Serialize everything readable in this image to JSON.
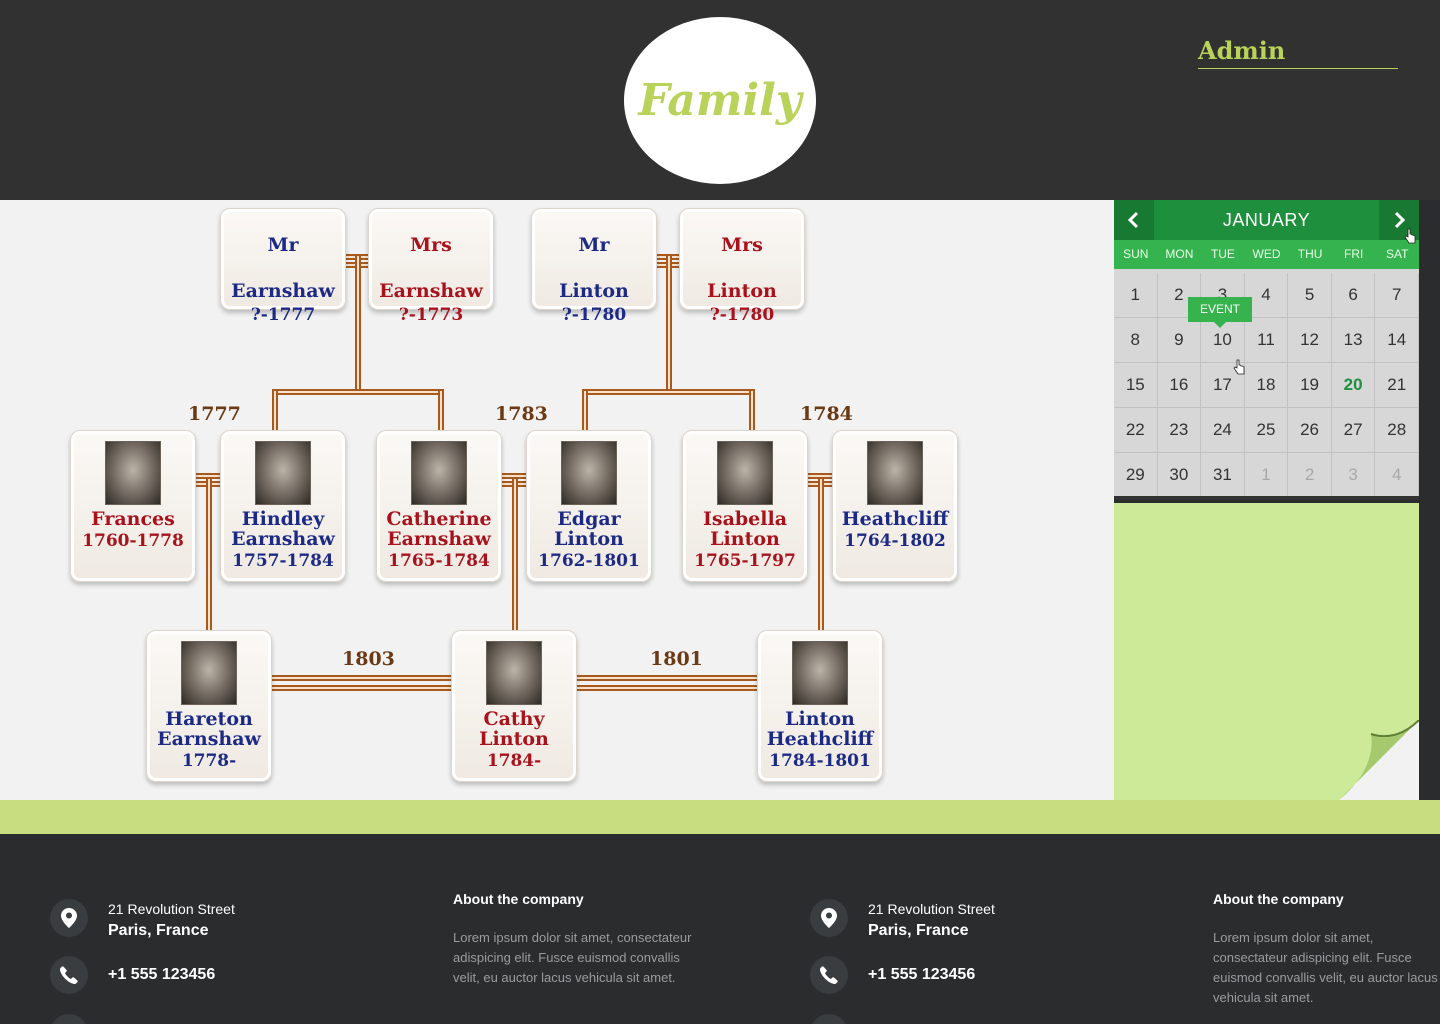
{
  "header": {
    "logo": "Family",
    "admin_link": "Admin"
  },
  "family_tree": {
    "grandparents": [
      {
        "name_line1": "Mr",
        "name_line2": "Earnshaw",
        "years": "?-1777",
        "sex": "male"
      },
      {
        "name_line1": "Mrs",
        "name_line2": "Earnshaw",
        "years": "?-1773",
        "sex": "female"
      },
      {
        "name_line1": "Mr",
        "name_line2": "Linton",
        "years": "?-1780",
        "sex": "male"
      },
      {
        "name_line1": "Mrs",
        "name_line2": "Linton",
        "years": "?-1780",
        "sex": "female"
      }
    ],
    "parents": [
      {
        "name_line1": "Frances",
        "name_line2": "",
        "years": "1760-1778",
        "sex": "female"
      },
      {
        "name_line1": "Hindley",
        "name_line2": "Earnshaw",
        "years": "1757-1784",
        "sex": "male"
      },
      {
        "name_line1": "Catherine",
        "name_line2": "Earnshaw",
        "years": "1765-1784",
        "sex": "female"
      },
      {
        "name_line1": "Edgar",
        "name_line2": "Linton",
        "years": "1762-1801",
        "sex": "male"
      },
      {
        "name_line1": "Isabella",
        "name_line2": "Linton",
        "years": "1765-1797",
        "sex": "female"
      },
      {
        "name_line1": "Heathcliff",
        "name_line2": "",
        "years": "1764-1802",
        "sex": "male"
      }
    ],
    "children": [
      {
        "name_line1": "Hareton",
        "name_line2": "Earnshaw",
        "years": "1778-",
        "sex": "male"
      },
      {
        "name_line1": "Cathy",
        "name_line2": "Linton",
        "years": "1784-",
        "sex": "female"
      },
      {
        "name_line1": "Linton",
        "name_line2": "Heathcliff",
        "years": "1784-1801",
        "sex": "male"
      }
    ],
    "marriage_years": [
      "1777",
      "1783",
      "1784",
      "1803",
      "1801"
    ]
  },
  "calendar": {
    "month": "JANUARY",
    "weekdays": [
      "SUN",
      "MON",
      "TUE",
      "WED",
      "THU",
      "FRI",
      "SAT"
    ],
    "days": [
      {
        "d": "1",
        "muted": false
      },
      {
        "d": "2",
        "muted": false
      },
      {
        "d": "3",
        "muted": false
      },
      {
        "d": "4",
        "muted": false
      },
      {
        "d": "5",
        "muted": false
      },
      {
        "d": "6",
        "muted": false
      },
      {
        "d": "7",
        "muted": false
      },
      {
        "d": "8",
        "muted": false
      },
      {
        "d": "9",
        "muted": false
      },
      {
        "d": "10",
        "muted": false
      },
      {
        "d": "11",
        "muted": false
      },
      {
        "d": "12",
        "muted": false
      },
      {
        "d": "13",
        "muted": false
      },
      {
        "d": "14",
        "muted": false
      },
      {
        "d": "15",
        "muted": false
      },
      {
        "d": "16",
        "muted": false
      },
      {
        "d": "17",
        "muted": false
      },
      {
        "d": "18",
        "muted": false
      },
      {
        "d": "19",
        "muted": false
      },
      {
        "d": "20",
        "muted": false
      },
      {
        "d": "21",
        "muted": false
      },
      {
        "d": "22",
        "muted": false
      },
      {
        "d": "23",
        "muted": false
      },
      {
        "d": "24",
        "muted": false
      },
      {
        "d": "25",
        "muted": false
      },
      {
        "d": "26",
        "muted": false
      },
      {
        "d": "27",
        "muted": false
      },
      {
        "d": "28",
        "muted": false
      },
      {
        "d": "29",
        "muted": false
      },
      {
        "d": "30",
        "muted": false
      },
      {
        "d": "31",
        "muted": false
      },
      {
        "d": "1",
        "muted": true
      },
      {
        "d": "2",
        "muted": true
      },
      {
        "d": "3",
        "muted": true
      },
      {
        "d": "4",
        "muted": true
      }
    ],
    "today": "20",
    "event_label": "EVENT"
  },
  "footer": {
    "columns": [
      {
        "address_line1": "21 Revolution Street",
        "address_line2": "Paris, France",
        "phone": "+1 555 123456"
      },
      {
        "heading": "About the company",
        "text": "Lorem ipsum dolor sit amet, consectateur adispicing elit. Fusce euismod convallis velit, eu auctor lacus vehicula sit amet."
      },
      {
        "address_line1": "21 Revolution Street",
        "address_line2": "Paris, France",
        "phone": "+1 555 123456"
      },
      {
        "heading": "About the company",
        "text": "Lorem ipsum dolor sit amet, consectateur adispicing elit. Fusce euismod convallis velit, eu auctor lacus vehicula sit amet."
      }
    ]
  },
  "colors": {
    "header_bg": "#313131",
    "accent_green": "#b9d25a",
    "calendar_green": "#1e8f3c",
    "note_green": "#ccea98",
    "male_text": "#1c2a86",
    "female_text": "#a8121c",
    "connector": "#a85a1e"
  }
}
